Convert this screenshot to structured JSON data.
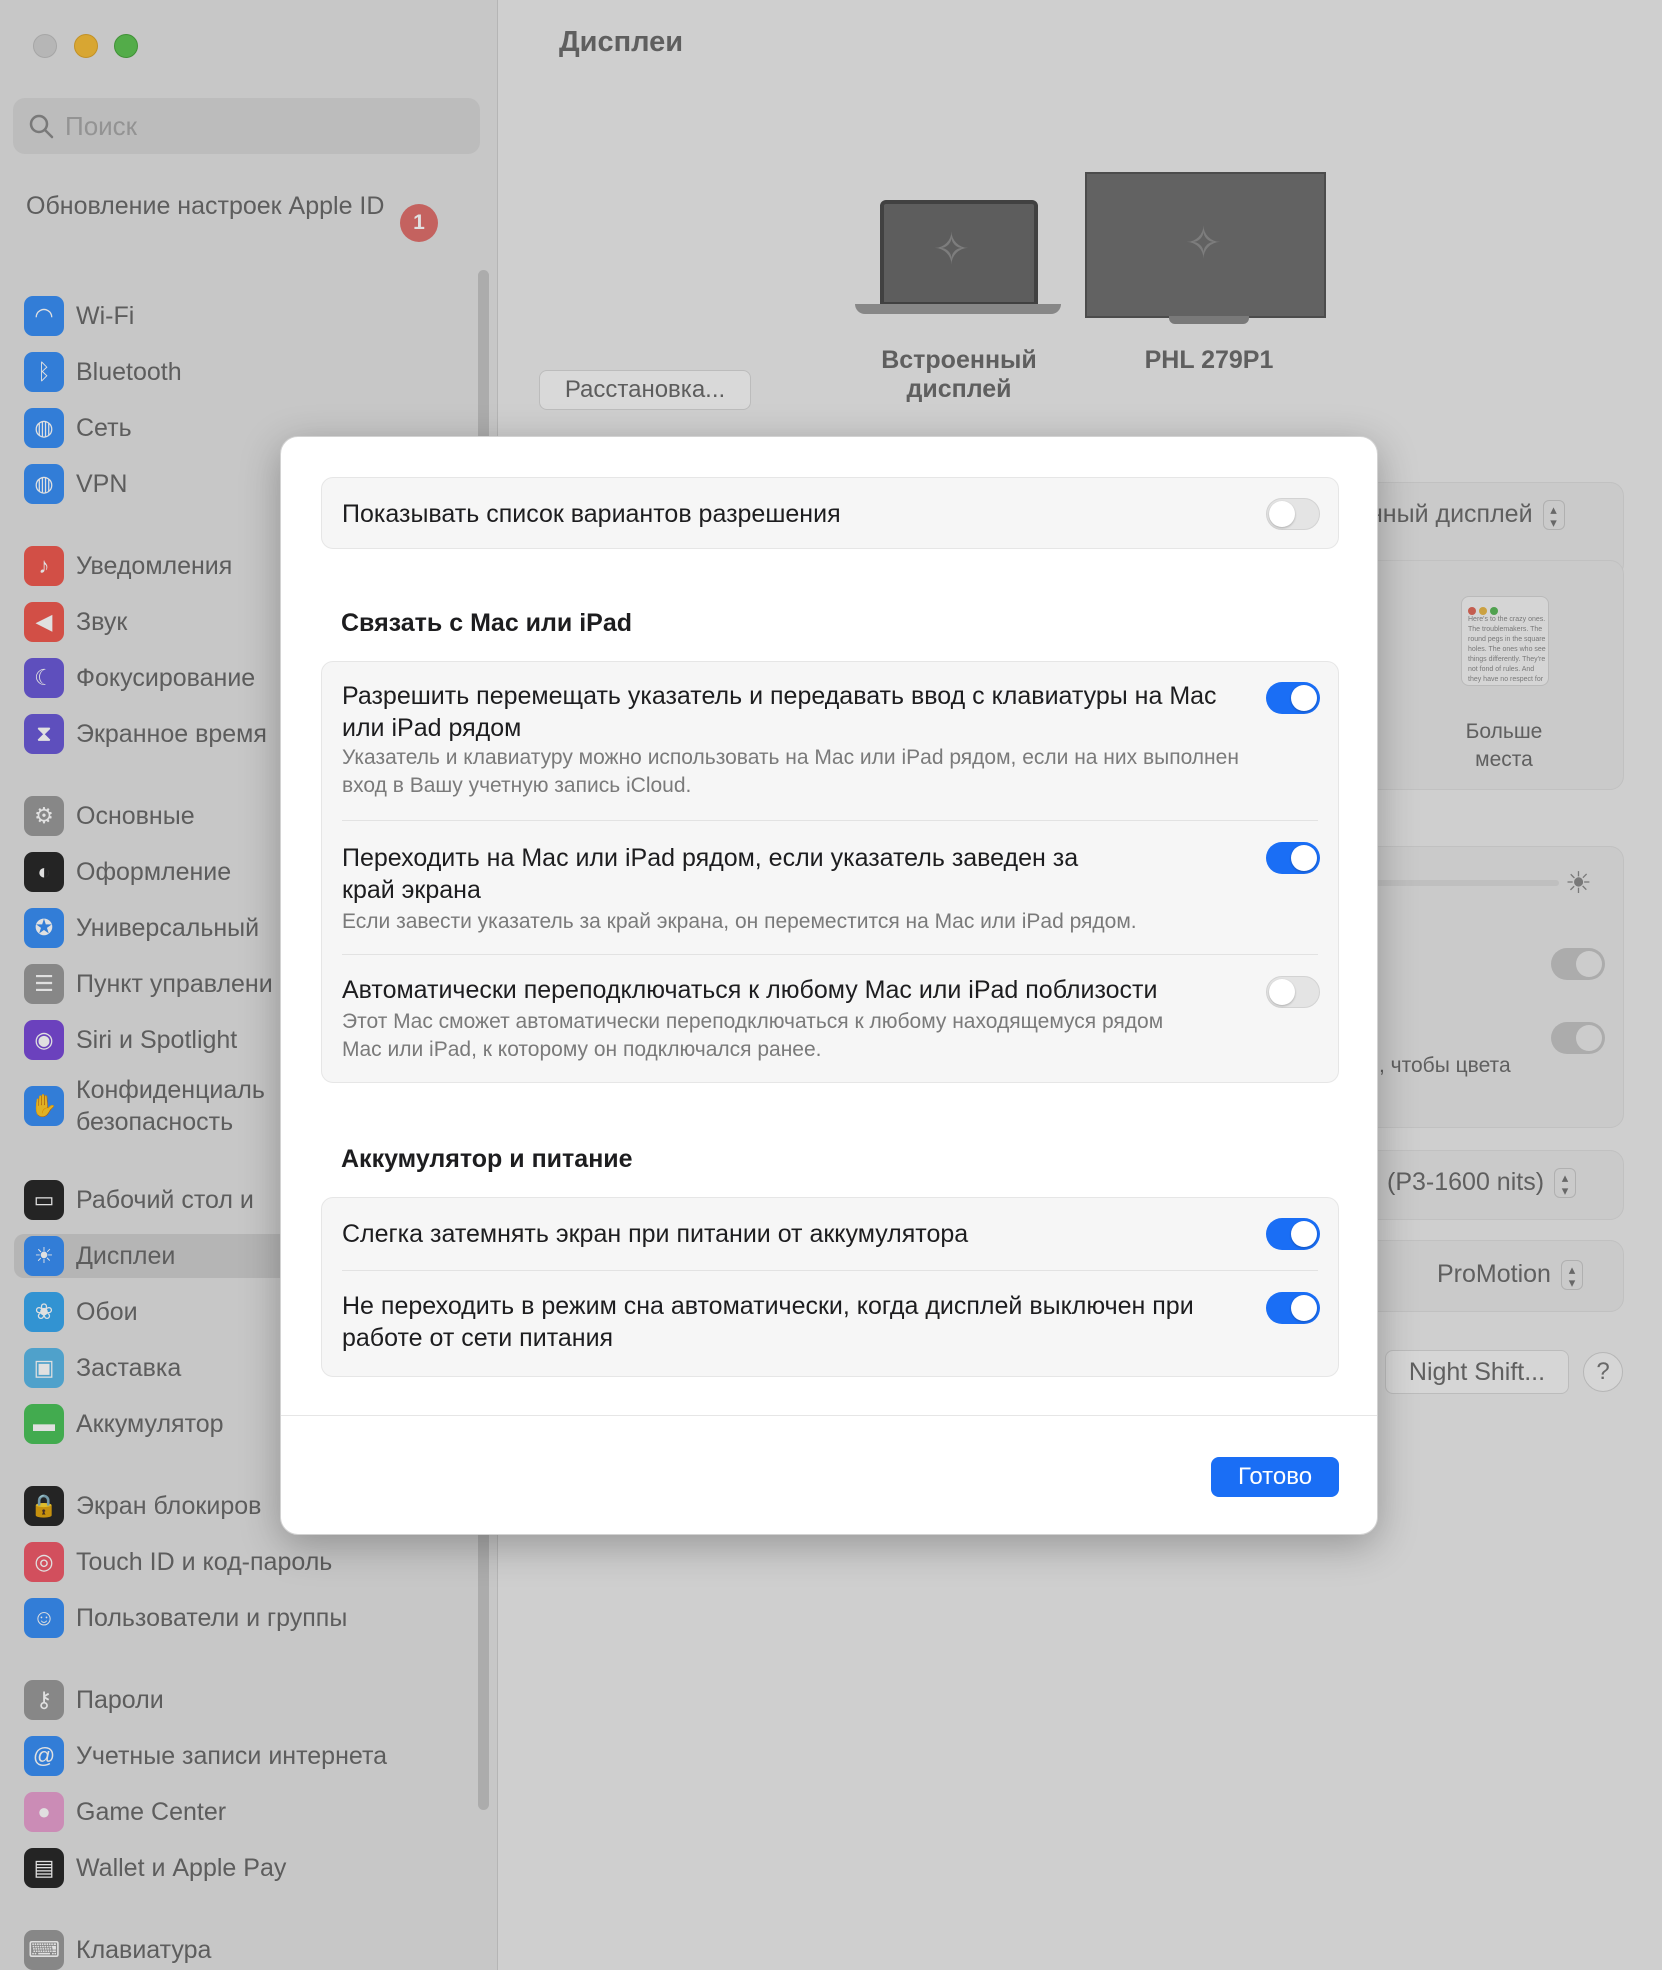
{
  "window": {
    "title": "Дисплеи"
  },
  "search": {
    "placeholder": "Поиск"
  },
  "sidebar": {
    "update_label": "Обновление настроек Apple ID",
    "update_badge": "1",
    "items": [
      {
        "label": "Wi-Fi",
        "icon": "wifi-icon",
        "color": "#3a8ff5"
      },
      {
        "label": "Bluetooth",
        "icon": "bluetooth-icon",
        "color": "#3a8ff5"
      },
      {
        "label": "Сеть",
        "icon": "globe-icon",
        "color": "#3a8ff5"
      },
      {
        "label": "VPN",
        "icon": "vpn-globe-icon",
        "color": "#3a8ff5"
      },
      {
        "label": "Уведомления",
        "icon": "bell-icon",
        "color": "#f05a50"
      },
      {
        "label": "Звук",
        "icon": "speaker-icon",
        "color": "#f05a50"
      },
      {
        "label": "Фокусирование",
        "icon": "moon-icon",
        "color": "#6b5ad8"
      },
      {
        "label": "Экранное время",
        "icon": "hourglass-icon",
        "color": "#6b5ad8"
      },
      {
        "label": "Основные",
        "icon": "gear-icon",
        "color": "#9a9a9a"
      },
      {
        "label": "Оформление",
        "icon": "appearance-icon",
        "color": "#2a2a2a"
      },
      {
        "label": "Универсальный",
        "icon": "accessibility-icon",
        "color": "#3a8ff5"
      },
      {
        "label": "Пункт управлени",
        "icon": "control-center-icon",
        "color": "#9a9a9a"
      },
      {
        "label": "Siri и Spotlight",
        "icon": "siri-icon",
        "color": "#7a4bd8"
      },
      {
        "label": "Конфиденциаль безопасность",
        "icon": "hand-icon",
        "color": "#3a8ff5"
      },
      {
        "label": "Рабочий стол и",
        "icon": "desktop-icon",
        "color": "#2a2a2a"
      },
      {
        "label": "Дисплеи",
        "icon": "display-brightness-icon",
        "color": "#3a8ff5"
      },
      {
        "label": "Обои",
        "icon": "flower-icon",
        "color": "#3aa8f0"
      },
      {
        "label": "Заставка",
        "icon": "screensaver-icon",
        "color": "#5ab8e8"
      },
      {
        "label": "Аккумулятор",
        "icon": "battery-icon",
        "color": "#4cc35a"
      },
      {
        "label": "Экран блокиров",
        "icon": "lock-icon",
        "color": "#2a2a2a"
      },
      {
        "label": "Touch ID и код-пароль",
        "icon": "fingerprint-icon",
        "color": "#f05a6a"
      },
      {
        "label": "Пользователи и группы",
        "icon": "users-icon",
        "color": "#3a8ff5"
      },
      {
        "label": "Пароли",
        "icon": "key-icon",
        "color": "#9a9a9a"
      },
      {
        "label": "Учетные записи интернета",
        "icon": "at-icon",
        "color": "#3a8ff5"
      },
      {
        "label": "Game Center",
        "icon": "game-center-icon",
        "color": "#e8a0d0"
      },
      {
        "label": "Wallet и Apple Pay",
        "icon": "wallet-icon",
        "color": "#2a2a2a"
      },
      {
        "label": "Клавиатура",
        "icon": "keyboard-icon",
        "color": "#9a9a9a"
      }
    ]
  },
  "main": {
    "arrange_button": "Расстановка...",
    "displays": [
      {
        "name": "Встроенный дисплей"
      },
      {
        "name": "PHL 279P1"
      }
    ],
    "bg_main_display_select": "нный дисплей",
    "bg_more_space": "Больше места",
    "bg_colors_text": ", чтобы цвета",
    "bg_preset": "(P3-1600 nits)",
    "bg_refresh": "ProMotion",
    "night_shift_button": "Night Shift...",
    "help_button": "?",
    "mini_window_text": "Here's to the crazy ones. The troublemakers. The round pegs in the square holes. The ones who see things differently. They're not fond of rules. And they have no respect for the status quo. You can quote them, disagree with them. About the only thing Because they change"
  },
  "modal": {
    "resolution_row": {
      "title": "Показывать список вариантов разрешения",
      "on": false
    },
    "section_link": "Связать с Mac или iPad",
    "link_rows": [
      {
        "title": "Разрешить перемещать указатель и передавать ввод с клавиатуры на Mac или iPad рядом",
        "subtitle": "Указатель и клавиатуру можно использовать на Mac или iPad рядом, если на них выполнен вход в Вашу учетную запись iCloud.",
        "on": true
      },
      {
        "title": "Переходить на Mac или iPad рядом, если указатель заведен за край экрана",
        "subtitle": "Если завести указатель за край экрана, он переместится на Mac или iPad рядом.",
        "on": true
      },
      {
        "title": "Автоматически переподключаться к любому Mac или iPad поблизости",
        "subtitle": "Этот Mac сможет автоматически переподключаться к любому находящемуся рядом Mac или iPad, к которому он подключался ранее.",
        "on": false
      }
    ],
    "section_battery": "Аккумулятор и питание",
    "battery_rows": [
      {
        "title": "Слегка затемнять экран при питании от аккумулятора",
        "on": true
      },
      {
        "title": "Не переходить в режим сна автоматически, когда дисплей выключен при работе от сети питания",
        "on": true
      }
    ],
    "done_button": "Готово"
  },
  "colors": {
    "accent": "#1a6ef5",
    "badge": "#e0706d"
  }
}
